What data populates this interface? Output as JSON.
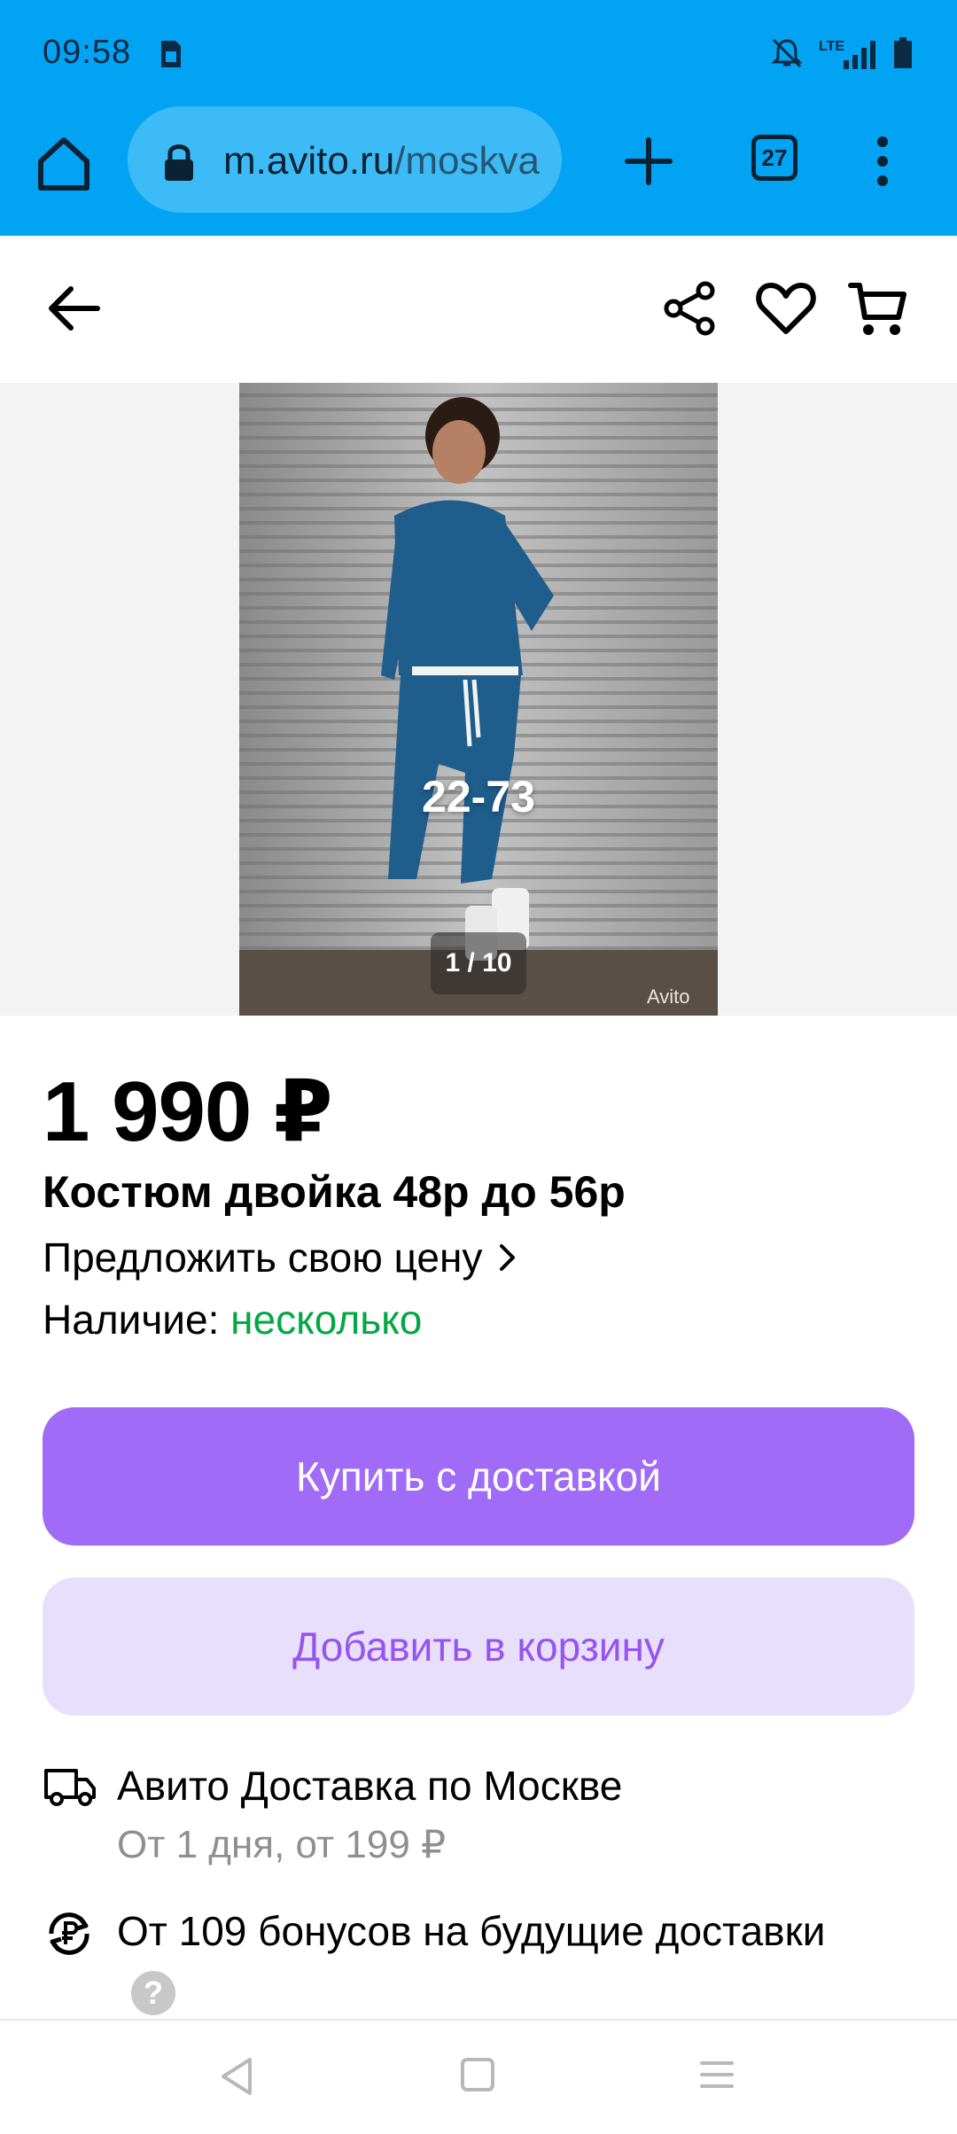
{
  "status_bar": {
    "time": "09:58",
    "network": "LTE"
  },
  "browser": {
    "url_domain": "m.avito.ru",
    "url_path": "/moskva",
    "tab_count": "27"
  },
  "gallery": {
    "watermark": "22-73",
    "counter": "1 / 10",
    "brand_mark": "Avito"
  },
  "product": {
    "price": "1 990 ₽",
    "title": "Костюм двойка 48р до 56р",
    "offer_price_label": "Предложить свою цену",
    "availability_label": "Наличие:",
    "availability_value": "несколько"
  },
  "actions": {
    "buy_label": "Купить с доставкой",
    "add_to_cart_label": "Добавить в корзину"
  },
  "delivery": {
    "title": "Авито Доставка по Москве",
    "subtitle": "От 1 дня, от 199 ₽",
    "bonus_text": "От 109 бонусов на будущие доставки",
    "help_symbol": "?"
  },
  "colors": {
    "browser_accent": "#03a3f4",
    "buy_button": "#a06bf6",
    "cart_button_bg": "#e8dffd",
    "availability": "#02a843"
  },
  "icons": {
    "home": "home-icon",
    "lock": "lock-icon",
    "new_tab": "plus-icon",
    "menu": "more-vert-icon",
    "back": "arrow-left-icon",
    "share": "share-icon",
    "favorite": "heart-icon",
    "cart": "cart-icon",
    "delivery": "truck-icon",
    "bonus": "ruble-cycle-icon"
  }
}
